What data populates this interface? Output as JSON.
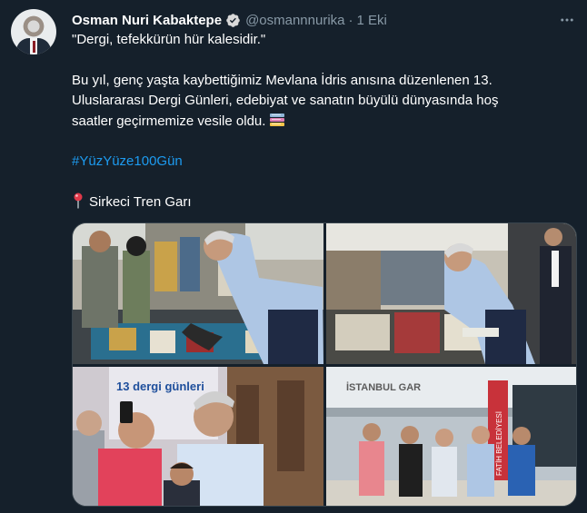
{
  "tweet": {
    "author_name": "Osman Nuri Kabaktepe",
    "handle": "@osmannnurika",
    "separator": "·",
    "time": "1 Eki",
    "body_lines_1": [
      "\"Dergi, tefekkürün hür kalesidir.\""
    ],
    "body_lines_2": [
      "Bu yıl, genç yaşta kaybettiğimiz Mevlana İdris anısına düzenlenen 13.",
      "Uluslararası Dergi Günleri, edebiyat ve sanatın büyülü dünyasında hoş",
      "saatler geçirmemize vesile oldu."
    ],
    "hashtag": "#YüzYüze100Gün",
    "location": "Sirkeci Tren Garı",
    "more_icon": "more-horizontal-icon",
    "verified_icon": "verified-badge-icon",
    "books_emoji": "books-emoji-icon",
    "pin_emoji": "round-pushpin-icon"
  },
  "media": {
    "photo3_sign_text": "13 dergi günleri",
    "photo4_sign_text": "İSTANBUL GAR",
    "photo4_banner_text": "FATİH BELEDİYESİ"
  },
  "colors": {
    "background": "#15202b",
    "text": "#ffffff",
    "secondary": "#8899a6",
    "link": "#1d9bf0",
    "border": "#38444d",
    "verified": "#1d9bf0"
  }
}
